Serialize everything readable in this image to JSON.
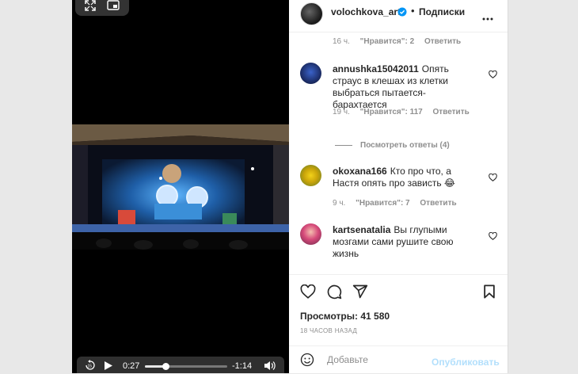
{
  "video": {
    "current_time": "0:27",
    "remaining_time": "-1:14",
    "progress": 0.25
  },
  "post": {
    "author": {
      "username": "volochkova_art",
      "verified": true,
      "separator": "•",
      "follow_label": "Подписки"
    },
    "comments": [
      {
        "meta": {
          "time": "16 ч.",
          "likes": "\"Нравится\": 2",
          "reply_label": "Ответить"
        }
      },
      {
        "username": "annushka15042011",
        "text": "Опять страус в клешах из клетки выбраться пытается-барахтается",
        "meta": {
          "time": "19 ч.",
          "likes": "\"Нравится\": 117",
          "reply_label": "Ответить"
        },
        "view_replies": "Посмотреть ответы (4)"
      },
      {
        "username": "okoxana166",
        "text": "Кто про что, а Настя опять про зависть 😂",
        "meta": {
          "time": "9 ч.",
          "likes": "\"Нравится\": 7",
          "reply_label": "Ответить"
        }
      },
      {
        "username": "kartsenatalia",
        "text": "Вы глупыми мозгами сами рушите свою жизнь"
      }
    ],
    "views": "Просмотры: 41 580",
    "timestamp": "18 ЧАСОВ НАЗАД",
    "add_comment_placeholder": "Добавьте",
    "publish_label": "Опубликовать"
  },
  "colors": {
    "background": "#e8e8e8",
    "text": "#262626",
    "secondary_text": "#8e8e8e",
    "publish_disabled": "#b2dffc",
    "verified": "#0095f6"
  },
  "icons": [
    "fullscreen-icon",
    "pip-icon",
    "verified-icon",
    "more-icon",
    "heart-icon",
    "comment-icon",
    "share-icon",
    "bookmark-icon",
    "emoji-icon",
    "replay-15-icon",
    "play-icon",
    "volume-icon"
  ]
}
